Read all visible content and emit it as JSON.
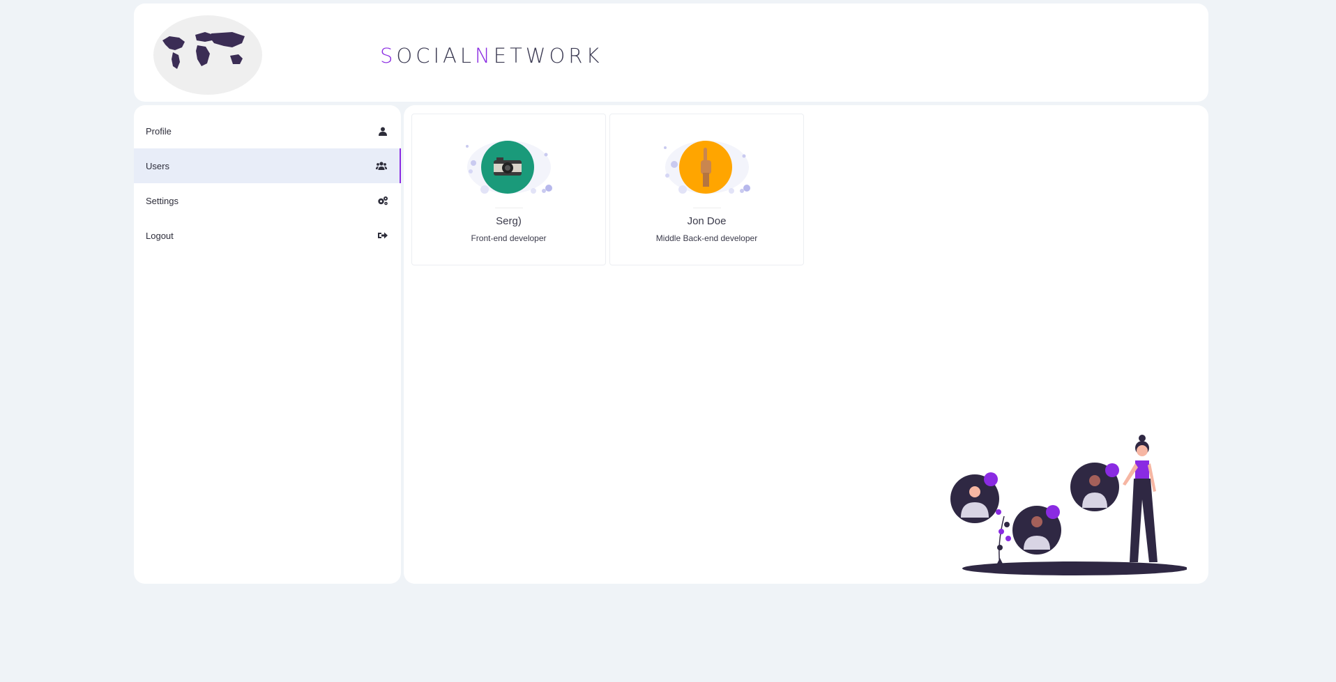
{
  "header": {
    "logo_prefix_accent": "S",
    "logo_part1": "OCIAL",
    "logo_mid_accent": "N",
    "logo_part2": "ETWORK"
  },
  "sidebar": {
    "items": [
      {
        "label": "Profile",
        "icon": "user-icon",
        "active": false
      },
      {
        "label": "Users",
        "icon": "users-icon",
        "active": true
      },
      {
        "label": "Settings",
        "icon": "gears-icon",
        "active": false
      },
      {
        "label": "Logout",
        "icon": "logout-icon",
        "active": false
      }
    ]
  },
  "users": [
    {
      "name": "Serg)",
      "role": "Front-end developer",
      "avatar_color": "#1a9a7a",
      "avatar_icon": "camera-icon"
    },
    {
      "name": "Jon Doe",
      "role": "Middle Back-end developer",
      "avatar_color": "#ffa500",
      "avatar_icon": "hand-icon"
    }
  ],
  "colors": {
    "accent": "#8a2be2",
    "background": "#eff3f7",
    "active_item_bg": "#e8edf8"
  }
}
